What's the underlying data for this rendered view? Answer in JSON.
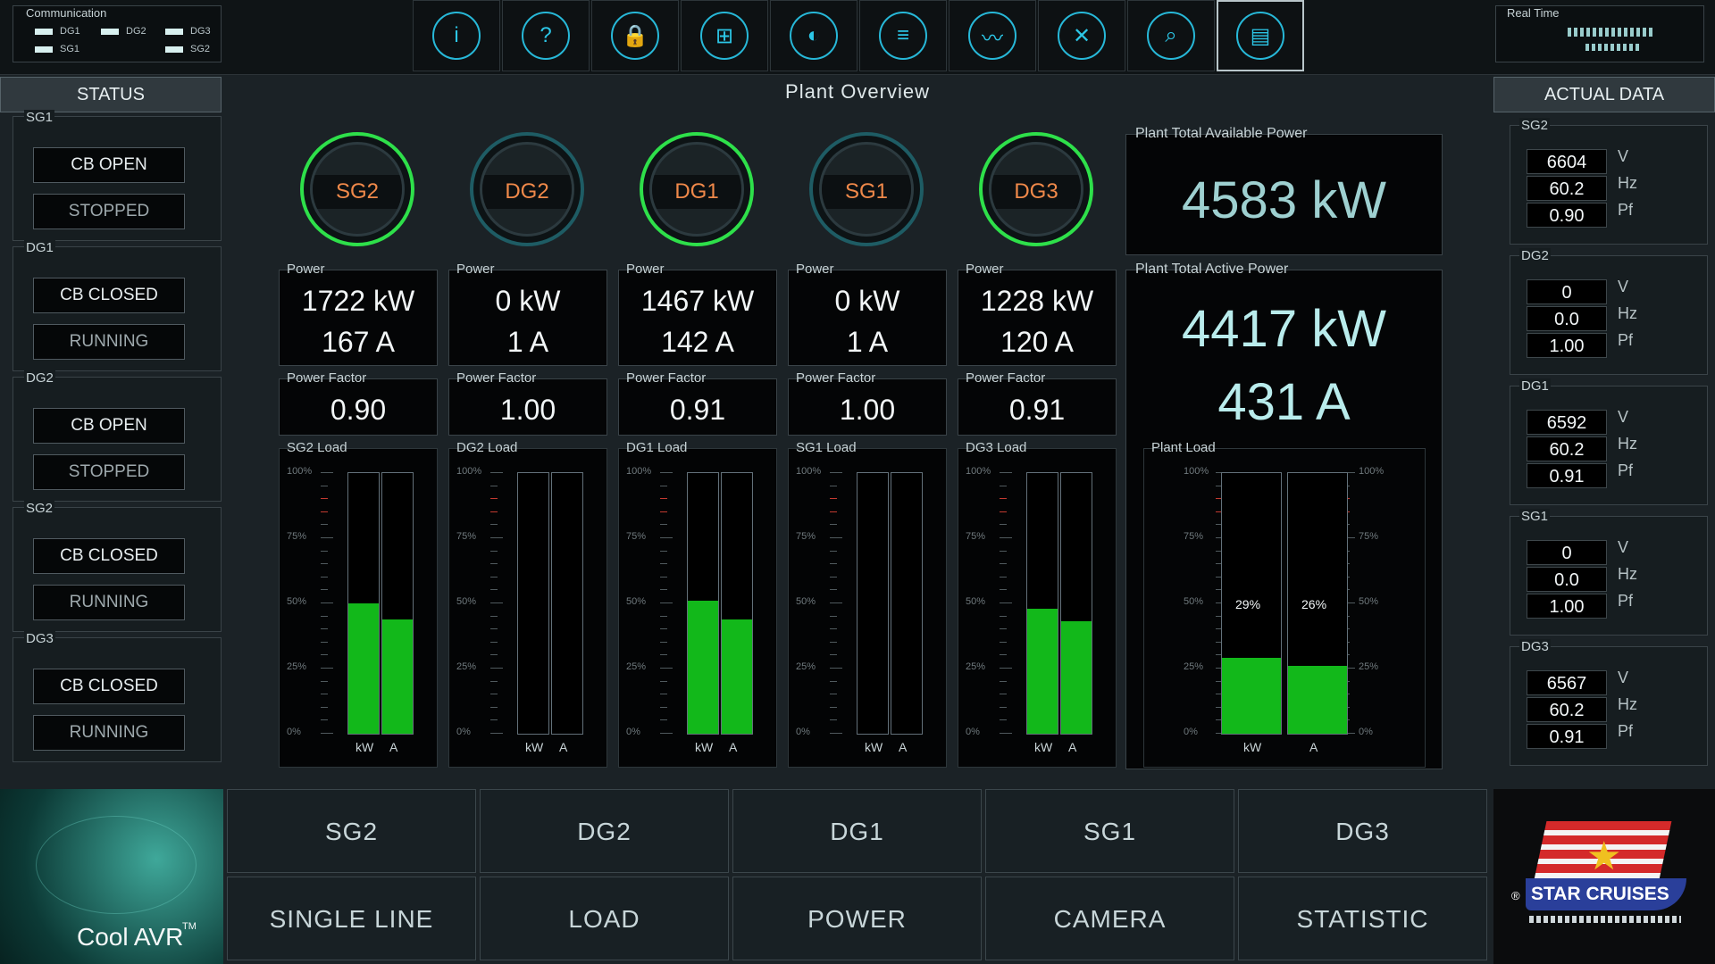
{
  "communication": {
    "title": "Communication",
    "items": [
      "DG1",
      "DG2",
      "DG3",
      "SG1",
      "SG2"
    ]
  },
  "toolbar": {
    "icons": [
      "info-icon",
      "help-icon",
      "lock-icon",
      "network-icon",
      "horn-icon",
      "list-icon",
      "trend-icon",
      "tools-icon",
      "zoom-icon",
      "print-icon"
    ],
    "glyphs": [
      "i",
      "?",
      "🔒",
      "⊞",
      "◐",
      "≡",
      "〰",
      "✕",
      "⌕",
      "▤"
    ]
  },
  "realtime": {
    "title": "Real Time"
  },
  "status": {
    "header": "STATUS",
    "groups": [
      {
        "name": "SG1",
        "cb": "CB OPEN",
        "state": "STOPPED"
      },
      {
        "name": "DG1",
        "cb": "CB CLOSED",
        "state": "RUNNING"
      },
      {
        "name": "DG2",
        "cb": "CB OPEN",
        "state": "STOPPED"
      },
      {
        "name": "SG2",
        "cb": "CB CLOSED",
        "state": "RUNNING"
      },
      {
        "name": "DG3",
        "cb": "CB CLOSED",
        "state": "RUNNING"
      }
    ]
  },
  "main": {
    "title": "Plant Overview",
    "power_label": "Power",
    "pf_label": "Power Factor",
    "gens": [
      {
        "name": "SG2",
        "active": true,
        "power": "1722 kW",
        "current": "167 A",
        "pf": "0.90",
        "load_title": "SG2 Load",
        "kw_pct": 50,
        "a_pct": 44
      },
      {
        "name": "DG2",
        "active": false,
        "power": "0 kW",
        "current": "1 A",
        "pf": "1.00",
        "load_title": "DG2 Load",
        "kw_pct": 0,
        "a_pct": 0
      },
      {
        "name": "DG1",
        "active": true,
        "power": "1467 kW",
        "current": "142 A",
        "pf": "0.91",
        "load_title": "DG1 Load",
        "kw_pct": 51,
        "a_pct": 44
      },
      {
        "name": "SG1",
        "active": false,
        "power": "0 kW",
        "current": "1 A",
        "pf": "1.00",
        "load_title": "SG1 Load",
        "kw_pct": 0,
        "a_pct": 0
      },
      {
        "name": "DG3",
        "active": true,
        "power": "1228 kW",
        "current": "120 A",
        "pf": "0.91",
        "load_title": "DG3 Load",
        "kw_pct": 48,
        "a_pct": 43
      }
    ],
    "axis": [
      "100%",
      "75%",
      "50%",
      "25%",
      "0%"
    ],
    "bar_labels": [
      "kW",
      "A"
    ],
    "plant": {
      "available_title": "Plant Total Available Power",
      "available_value": "4583 kW",
      "active_title": "Plant Total Active Power",
      "active_value": "4417 kW",
      "active_current": "431 A",
      "load_title": "Plant Load",
      "kw_pct": 29,
      "a_pct": 26,
      "kw_pct_label": "29%",
      "a_pct_label": "26%"
    }
  },
  "actual": {
    "header": "ACTUAL DATA",
    "units": [
      "V",
      "Hz",
      "Pf"
    ],
    "groups": [
      {
        "name": "SG2",
        "v": "6604",
        "hz": "60.2",
        "pf": "0.90"
      },
      {
        "name": "DG2",
        "v": "0",
        "hz": "0.0",
        "pf": "1.00"
      },
      {
        "name": "DG1",
        "v": "6592",
        "hz": "60.2",
        "pf": "0.91"
      },
      {
        "name": "SG1",
        "v": "0",
        "hz": "0.0",
        "pf": "1.00"
      },
      {
        "name": "DG3",
        "v": "6567",
        "hz": "60.2",
        "pf": "0.91"
      }
    ]
  },
  "nav": {
    "row1": [
      "SG2",
      "DG2",
      "DG1",
      "SG1",
      "DG3"
    ],
    "row2": [
      "SINGLE LINE",
      "LOAD",
      "POWER",
      "CAMERA",
      "STATISTIC"
    ]
  },
  "branding": {
    "left_logo": "Cool AVR",
    "left_tm": "TM",
    "right_logo": "STAR CRUISES",
    "registered": "®"
  },
  "colors": {
    "accent": "#27b8d8",
    "active_ring": "#2ee04a",
    "bar_fill": "#12b81a",
    "gen_label": "#f0894a"
  }
}
